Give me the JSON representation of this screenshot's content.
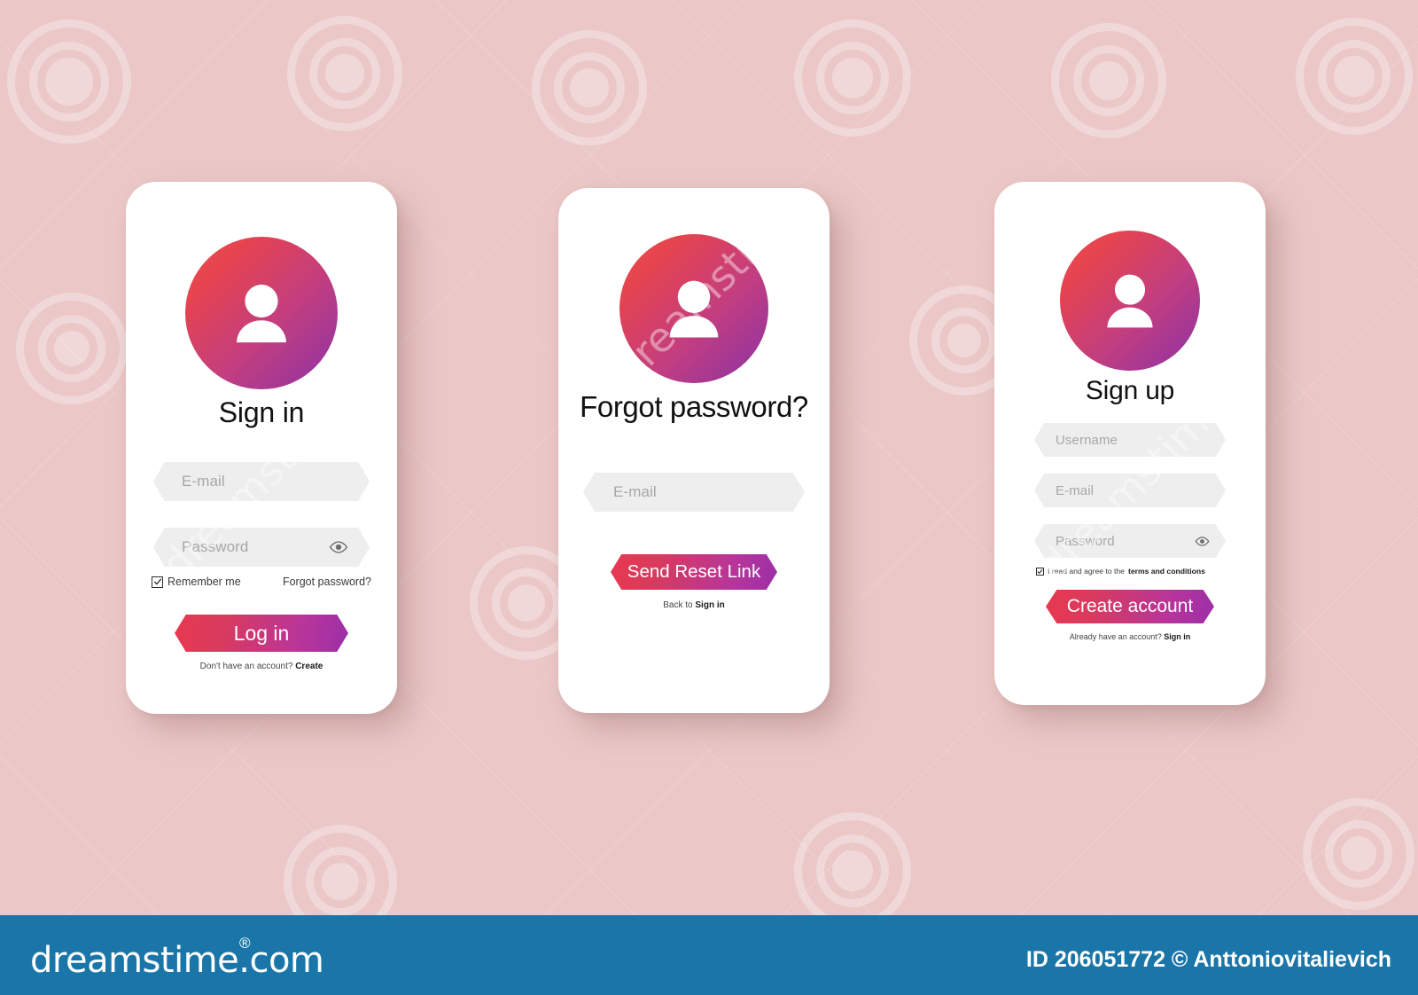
{
  "background": {
    "color": "#ebc8c7",
    "panel_color": "#ffffff"
  },
  "theme": {
    "gradient_start": "#ef4f4f",
    "gradient_end": "#8b32a6",
    "field_bg": "#eeeeee",
    "placeholder_color": "#a7a7a7",
    "footer_bar": "#1a76a8"
  },
  "screens": [
    {
      "id": "sign-in",
      "avatar_icon": "user-avatar-icon",
      "title": "Sign in",
      "fields": [
        {
          "name": "email",
          "placeholder": "E-mail",
          "value": "",
          "has_eye": false
        },
        {
          "name": "password",
          "placeholder": "Password",
          "value": "",
          "has_eye": true,
          "eye_icon": "eye-icon"
        }
      ],
      "checkbox": {
        "label": "Remember me",
        "checked": true,
        "check_icon": "check-icon"
      },
      "secondary_link": "Forgot password?",
      "button": {
        "label": "Log in"
      },
      "footer_prefix": "Don't have an account?",
      "footer_link": "Create"
    },
    {
      "id": "forgot-password",
      "avatar_icon": "user-avatar-icon",
      "title": "Forgot password?",
      "fields": [
        {
          "name": "email",
          "placeholder": "E-mail",
          "value": "",
          "has_eye": false
        }
      ],
      "button": {
        "label": "Send Reset Link"
      },
      "footer_prefix": "Back to",
      "footer_link": "Sign in"
    },
    {
      "id": "sign-up",
      "avatar_icon": "user-avatar-icon",
      "title": "Sign up",
      "fields": [
        {
          "name": "username",
          "placeholder": "Username",
          "value": "",
          "has_eye": false
        },
        {
          "name": "email",
          "placeholder": "E-mail",
          "value": "",
          "has_eye": false
        },
        {
          "name": "password",
          "placeholder": "Password",
          "value": "",
          "has_eye": true,
          "eye_icon": "eye-icon"
        }
      ],
      "checkbox": {
        "label_prefix": "I read and agree to the",
        "label_strong": "terms and conditions",
        "checked": true,
        "check_icon": "check-icon"
      },
      "button": {
        "label": "Create account"
      },
      "footer_prefix": "Already have an account?",
      "footer_link": "Sign in"
    }
  ],
  "watermark": {
    "brand": "dreamstime.com",
    "registered": "®",
    "credit": "ID 206051772 © Anttoniovitalievich",
    "diagonal_text": "dreamstime"
  }
}
